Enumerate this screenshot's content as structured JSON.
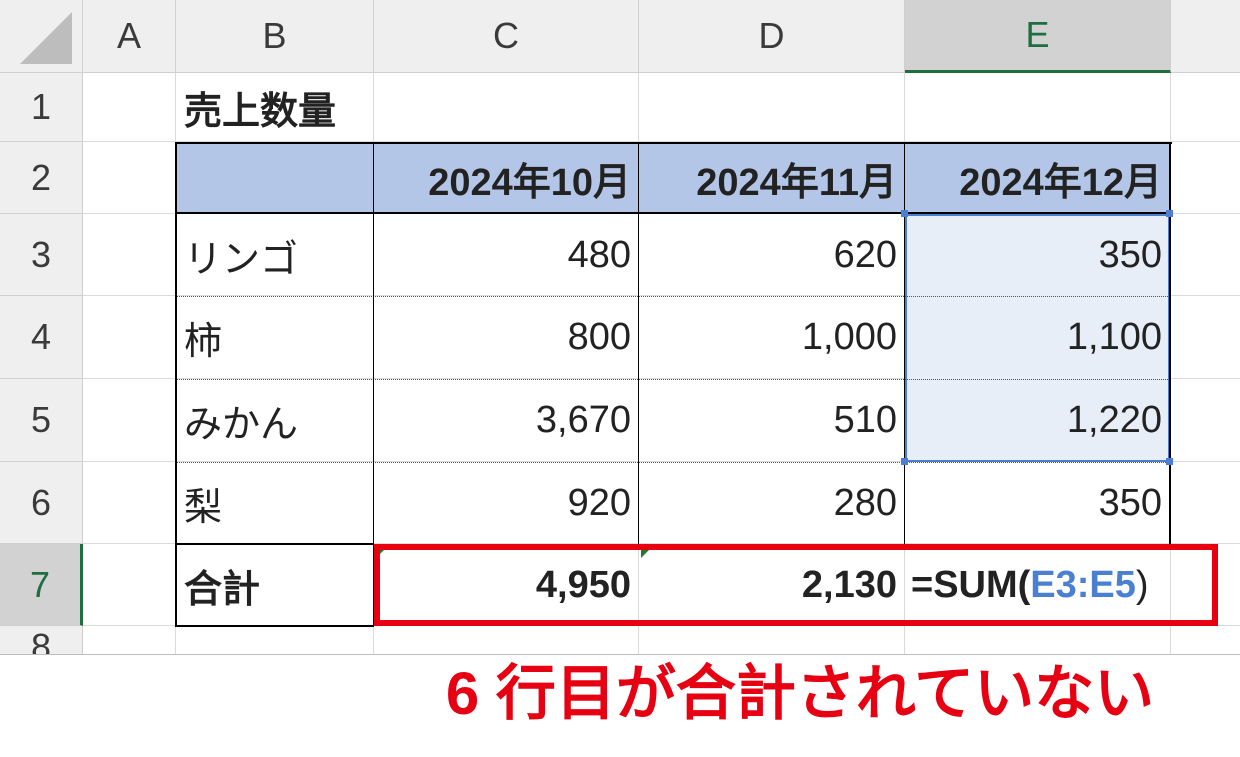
{
  "columns": [
    "A",
    "B",
    "C",
    "D",
    "E"
  ],
  "selected_column": "E",
  "rows": [
    "1",
    "2",
    "3",
    "4",
    "5",
    "6",
    "7",
    "8"
  ],
  "selected_row": "7",
  "sheet_title": "売上数量",
  "table": {
    "headers": [
      "",
      "2024年10月",
      "2024年11月",
      "2024年12月"
    ],
    "body": [
      [
        "リンゴ",
        "480",
        "620",
        "350"
      ],
      [
        "柿",
        "800",
        "1,000",
        "1,100"
      ],
      [
        "みかん",
        "3,670",
        "510",
        "1,220"
      ],
      [
        "梨",
        "920",
        "280",
        "350"
      ]
    ],
    "total": {
      "label": "合計",
      "c": "4,950",
      "d": "2,130",
      "e_prefix": "=SUM(",
      "e_range": "E3:E5",
      "e_suffix": ")"
    }
  },
  "annotation": "6 行目が合計されていない",
  "colors": {
    "header_fill": "#b4c6e7",
    "selection_fill": "#e8eef8",
    "range_ref": "#4a7fd1",
    "annotation": "#e60012"
  }
}
